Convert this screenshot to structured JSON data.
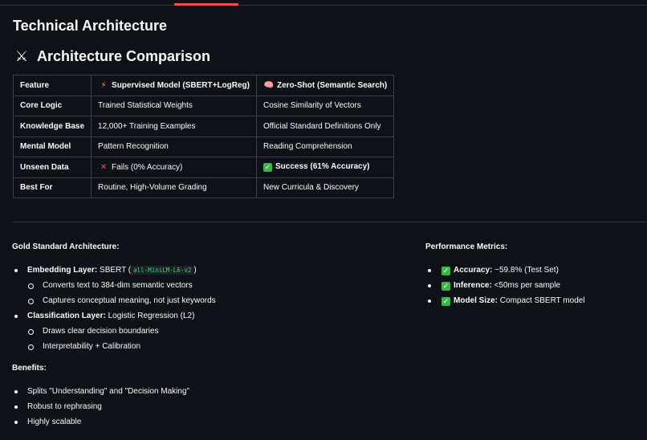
{
  "page_title": "Technical Architecture",
  "section": {
    "icon": "crossed-swords-icon",
    "icon_glyph": "⚔",
    "title": "Architecture Comparison"
  },
  "table": {
    "headers": [
      {
        "text": "Feature",
        "icon": ""
      },
      {
        "text": "Supervised Model (SBERT+LogReg)",
        "icon": "⚡"
      },
      {
        "text": "Zero-Shot (Semantic Search)",
        "icon": "🧠"
      }
    ],
    "rows": [
      {
        "feature": "Core Logic",
        "supervised": "Trained Statistical Weights",
        "zeroshot": "Cosine Similarity of Vectors"
      },
      {
        "feature": "Knowledge Base",
        "supervised": "12,000+ Training Examples",
        "zeroshot": "Official Standard Definitions Only"
      },
      {
        "feature": "Mental Model",
        "supervised": "Pattern Recognition",
        "zeroshot": "Reading Comprehension"
      },
      {
        "feature": "Unseen Data",
        "supervised": "Fails (0% Accuracy)",
        "zeroshot": "Success (61% Accuracy)"
      },
      {
        "feature": "Best For",
        "supervised": "Routine, High-Volume Grading",
        "zeroshot": "New Curricula & Discovery"
      }
    ]
  },
  "gold": {
    "heading": "Gold Standard Architecture:",
    "embedding_label": "Embedding Layer:",
    "embedding_text": " SBERT (",
    "embedding_code": "all-MiniLM-L6-v2",
    "embedding_close": ")",
    "embedding_sub": [
      "Converts text to 384-dim semantic vectors",
      "Captures conceptual meaning, not just keywords"
    ],
    "classification_label": "Classification Layer:",
    "classification_text": " Logistic Regression (L2)",
    "classification_sub": [
      "Draws clear decision boundaries",
      "Interpretability + Calibration"
    ]
  },
  "benefits": {
    "heading": "Benefits:",
    "items": [
      "Splits \"Understanding\" and \"Decision Making\"",
      "Robust to rephrasing",
      "Highly scalable"
    ]
  },
  "metrics": {
    "heading": "Performance Metrics:",
    "items": [
      {
        "label": "Accuracy:",
        "value": " ~59.8% (Test Set)"
      },
      {
        "label": "Inference:",
        "value": " <50ms per sample"
      },
      {
        "label": "Model Size:",
        "value": " Compact SBERT model"
      }
    ]
  }
}
